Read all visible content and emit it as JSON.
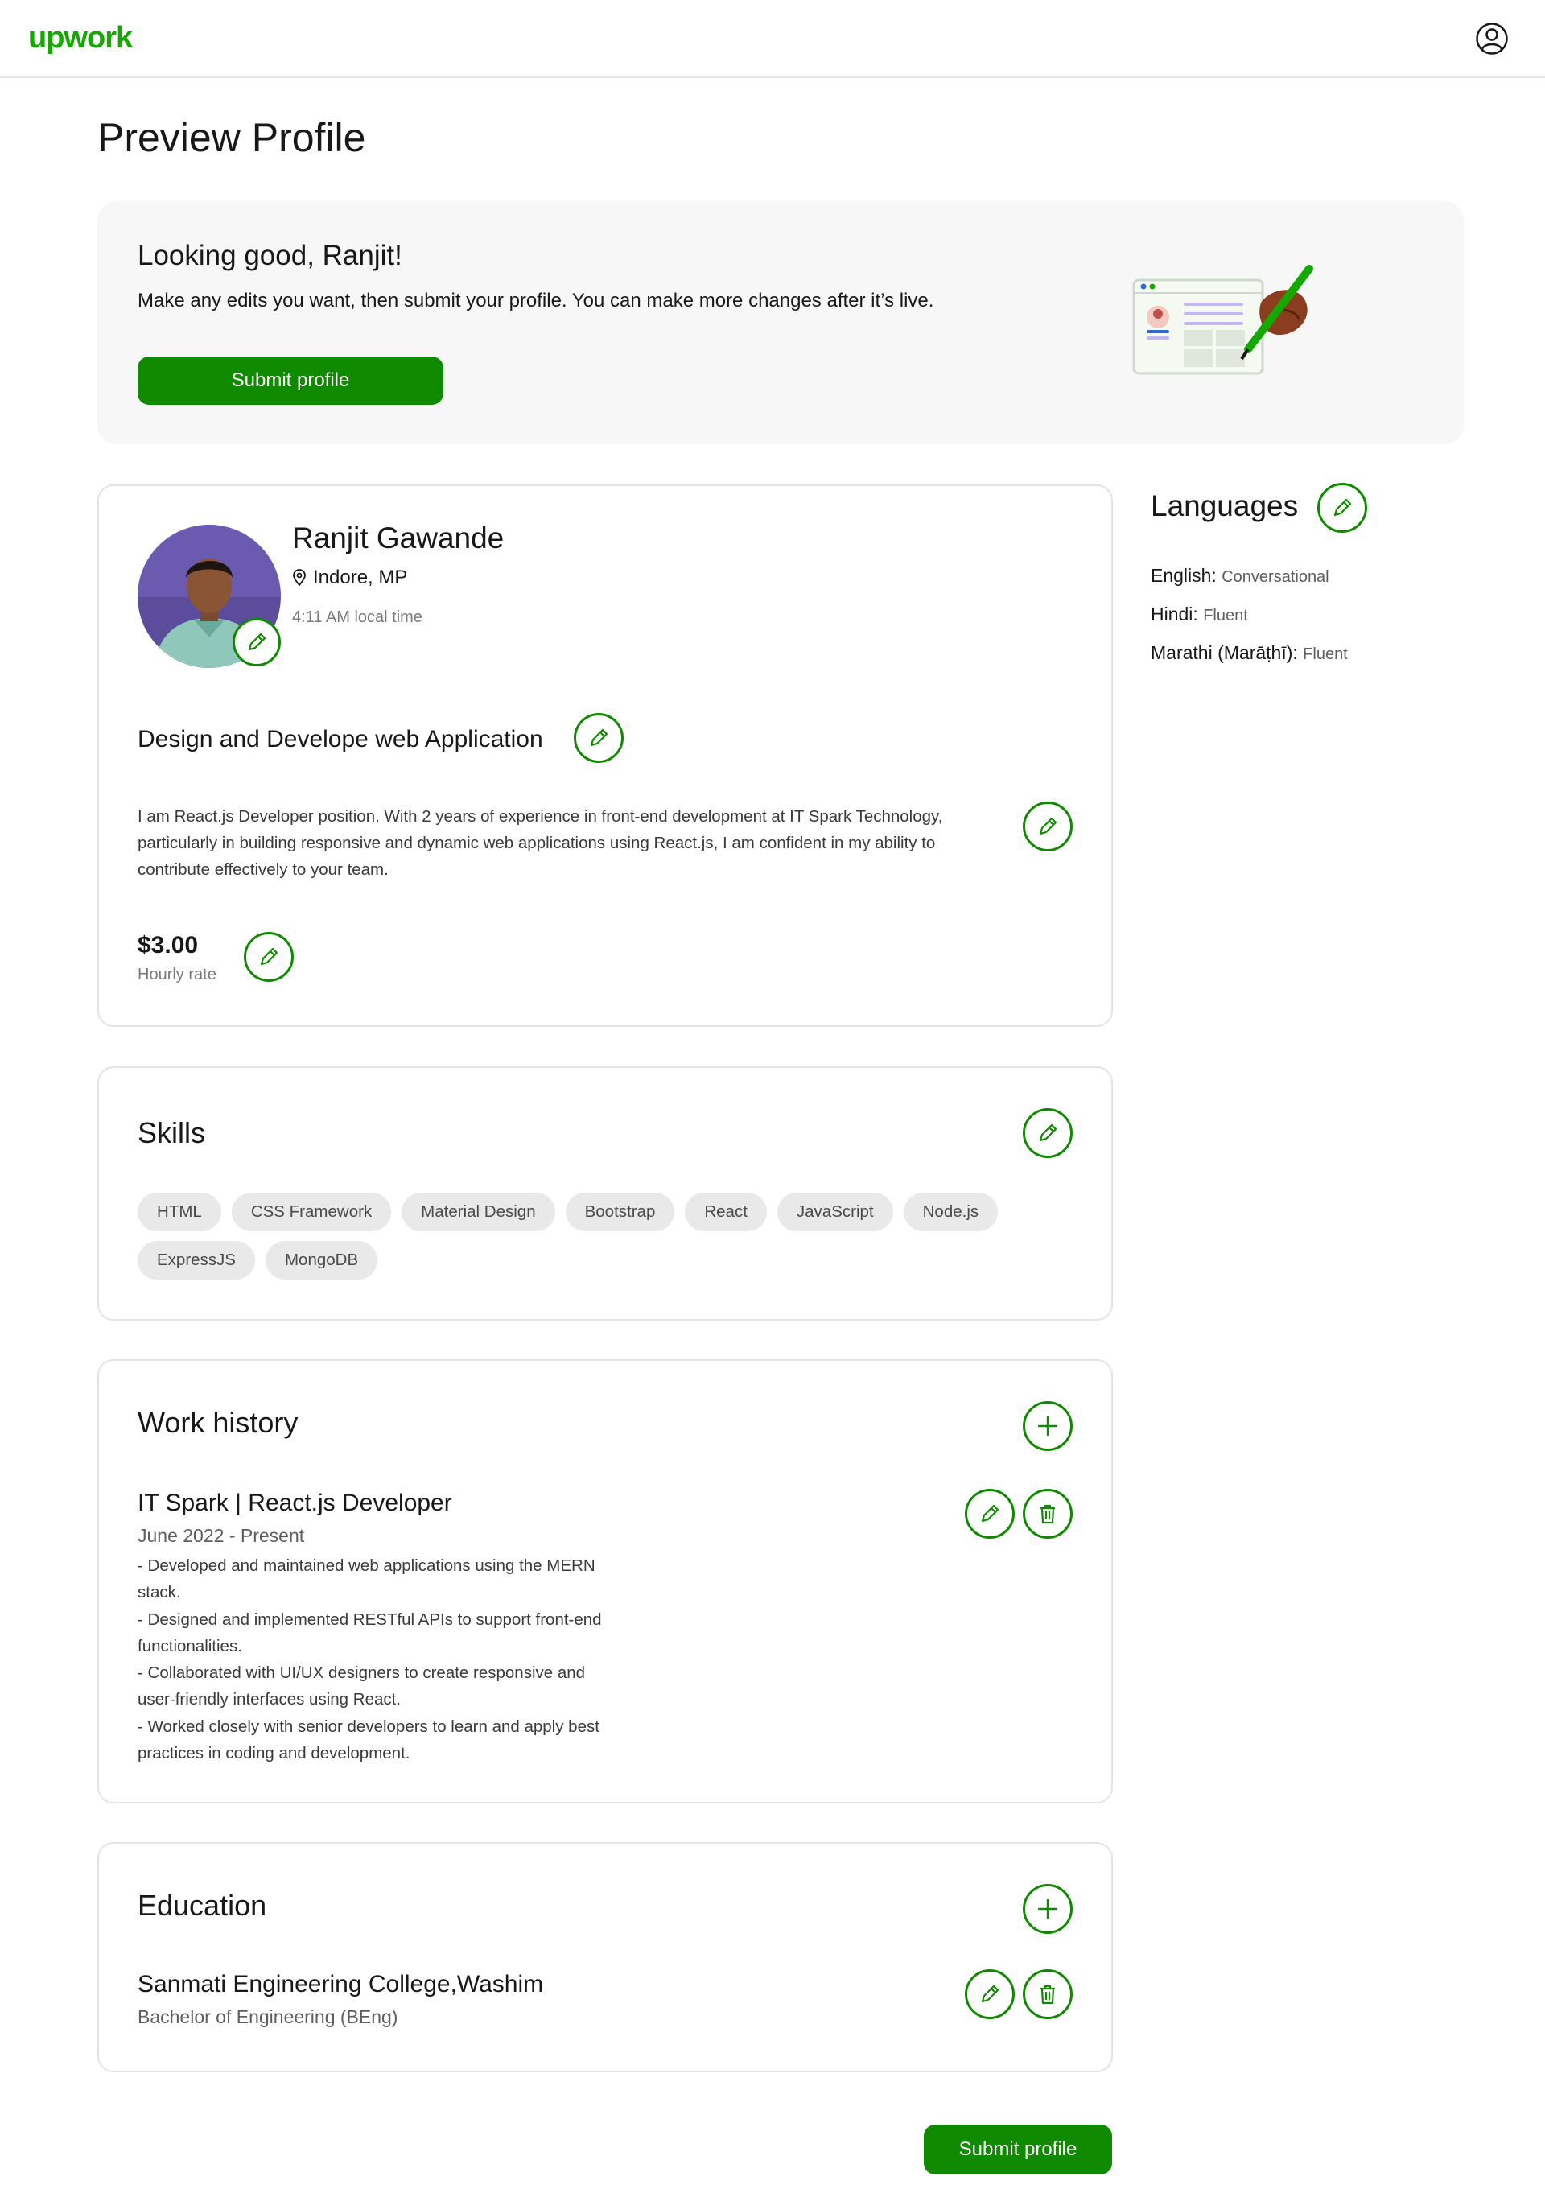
{
  "header": {
    "logo": "upwork",
    "user_icon": "user-circle-icon"
  },
  "page_title": "Preview Profile",
  "banner": {
    "heading": "Looking good, Ranjit!",
    "text": "Make any edits you want, then submit your profile. You can make more changes after it’s live.",
    "submit_label": "Submit profile"
  },
  "profile": {
    "name": "Ranjit Gawande",
    "location": "Indore, MP",
    "local_time": "4:11 AM local time",
    "title": "Design and Develope web Application",
    "overview": "I am React.js Developer position. With 2 years of experience in front-end development at IT Spark Technology, particularly in building responsive and dynamic web applications using React.js, I am confident in my ability to contribute effectively to your team.",
    "rate": "$3.00",
    "rate_label": "Hourly rate"
  },
  "languages": {
    "heading": "Languages",
    "items": [
      {
        "name": "English:",
        "level": "Conversational"
      },
      {
        "name": "Hindi:",
        "level": "Fluent"
      },
      {
        "name": "Marathi (Marāṭhī):",
        "level": "Fluent"
      }
    ]
  },
  "skills": {
    "heading": "Skills",
    "items": [
      "HTML",
      "CSS Framework",
      "Material Design",
      "Bootstrap",
      "React",
      "JavaScript",
      "Node.js",
      "ExpressJS",
      "MongoDB"
    ]
  },
  "work_history": {
    "heading": "Work history",
    "items": [
      {
        "title": "IT Spark | React.js Developer",
        "dates": "June 2022 - Present",
        "description": [
          "- Developed and maintained web applications using the MERN",
          "stack.",
          "- Designed and implemented RESTful APIs to support front-end",
          "functionalities.",
          "- Collaborated with UI/UX designers to create responsive and",
          "user-friendly interfaces using React.",
          "- Worked closely with senior developers to learn and apply best",
          "practices in coding and development."
        ]
      }
    ]
  },
  "education": {
    "heading": "Education",
    "items": [
      {
        "school": "Sanmati Engineering College,Washim",
        "degree": "Bachelor of Engineering (BEng)"
      }
    ]
  },
  "footer": {
    "submit_label": "Submit profile"
  },
  "colors": {
    "brand": "#108a00",
    "logo": "#14a800",
    "banner_bg": "#f7f7f7",
    "chip_bg": "#e9e9e9"
  }
}
